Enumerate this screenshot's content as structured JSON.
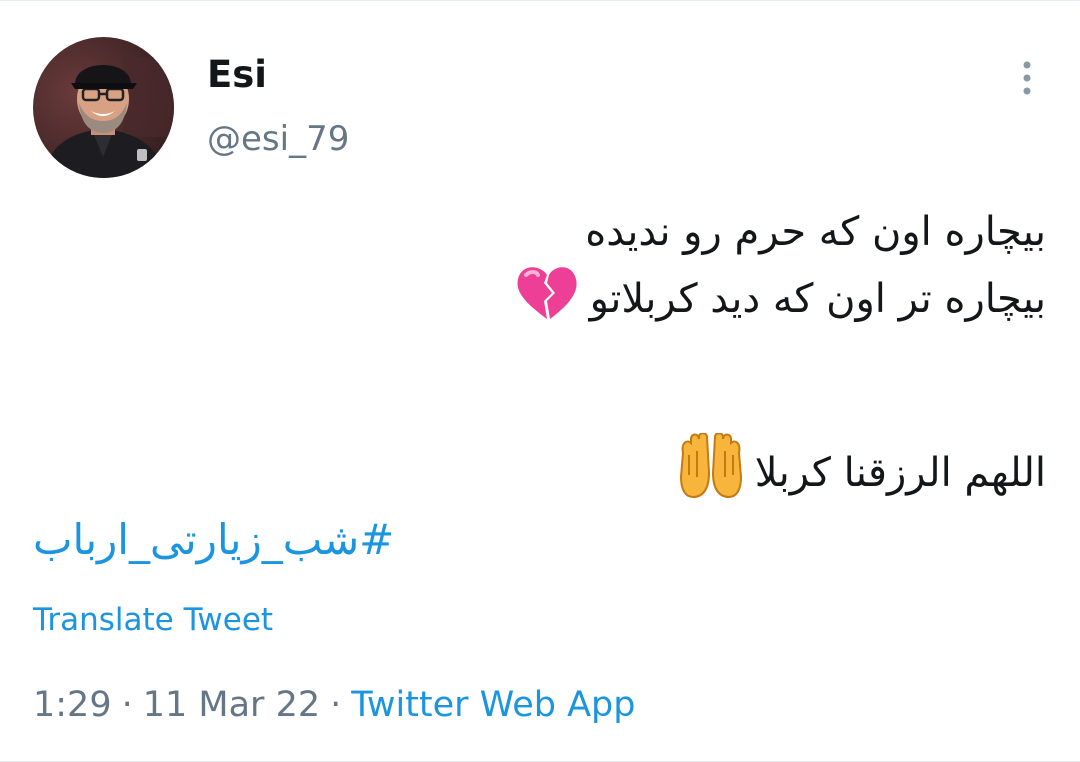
{
  "user": {
    "name": "Esi",
    "handle": "@esi_79"
  },
  "tweet": {
    "line1": "بیچاره اون که حرم رو ندیده",
    "line2": "بیچاره تر اون که دید کربلاتو",
    "line3": "اللهم الرزقنا کربلا",
    "hashtag": "#شب_زیارتی_ارباب",
    "line2_emoji": "broken-heart-icon",
    "line3_emoji": "palms-up-together-icon"
  },
  "translate_label": "Translate Tweet",
  "meta": {
    "time": "1:29",
    "separator": "·",
    "date": "11 Mar 22",
    "source": "Twitter Web App"
  },
  "colors": {
    "link": "#1b95e0",
    "secondary": "#657786",
    "text": "#14171a"
  }
}
